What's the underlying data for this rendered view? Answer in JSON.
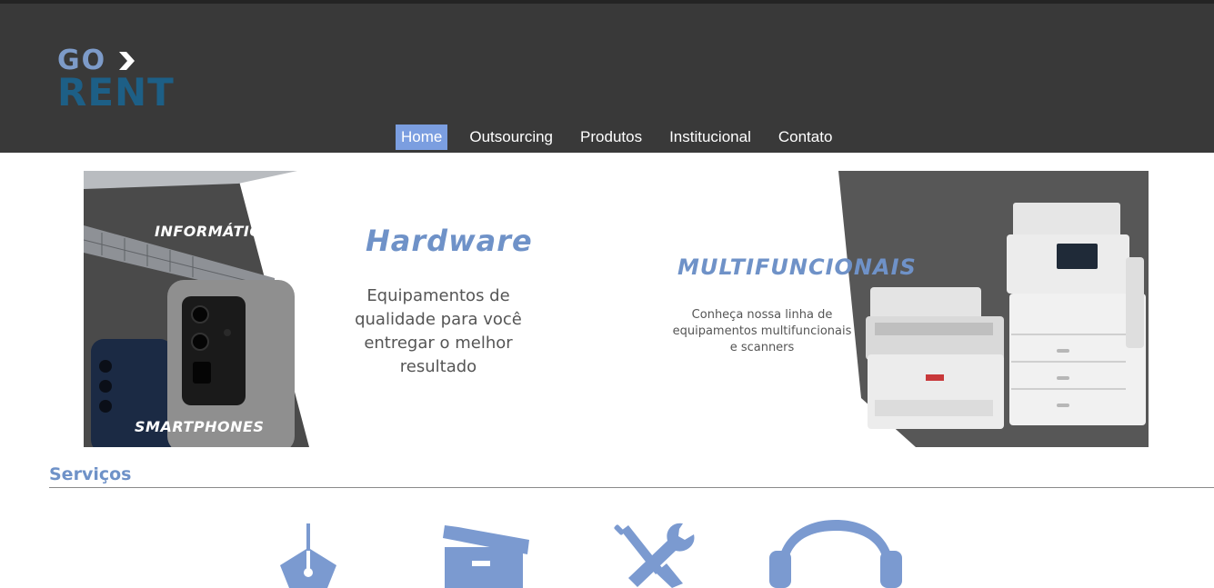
{
  "logo": {
    "line1": "GO",
    "line2": "RENT"
  },
  "nav": {
    "items": [
      {
        "label": "Home",
        "active": true
      },
      {
        "label": "Outsourcing",
        "active": false
      },
      {
        "label": "Produtos",
        "active": false
      },
      {
        "label": "Institucional",
        "active": false
      },
      {
        "label": "Contato",
        "active": false
      }
    ]
  },
  "banner": {
    "left_label_top": "INFORMÁTICA",
    "left_label_bottom": "SMARTPHONES",
    "hardware_title": "Hardware",
    "hardware_body": [
      "Equipamentos de",
      "qualidade para você",
      "entregar o melhor",
      "resultado"
    ],
    "multi_title": "MULTIFUNCIONAIS",
    "multi_body": [
      "Conheça nossa linha de",
      "equipamentos multifuncionais",
      "e scanners"
    ]
  },
  "services": {
    "title": "Serviços",
    "icons": [
      "pen-nib-icon",
      "box-icon",
      "tools-icon",
      "headset-icon"
    ],
    "icon_color": "#7b9ad0"
  },
  "colors": {
    "header_bg": "#393939",
    "accent": "#7b9ee0",
    "brand_light": "#7d9bc9",
    "brand_dark": "#1d5f86"
  }
}
